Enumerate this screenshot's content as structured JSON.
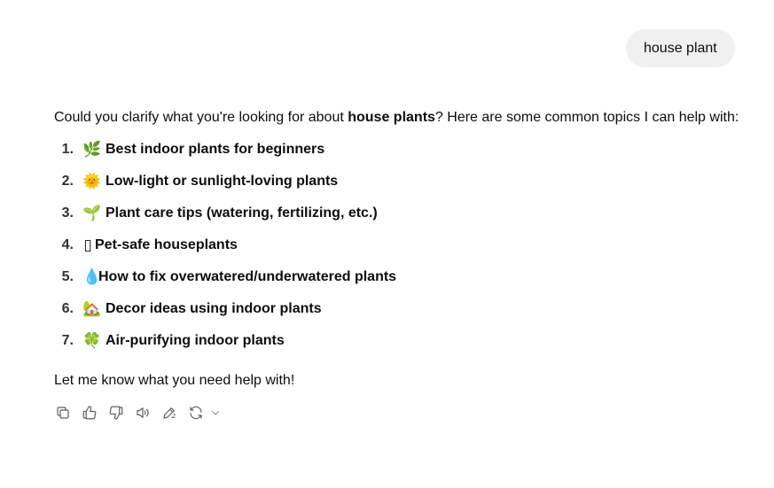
{
  "user_message": "house plant",
  "assistant": {
    "intro_before": "Could you clarify what you're looking for about ",
    "intro_bold": "house plants",
    "intro_after": "? Here are some common topics I can help with:",
    "topics": [
      {
        "num": "1.",
        "emoji": "🌿",
        "label": "Best indoor plants for beginners"
      },
      {
        "num": "2.",
        "emoji": "🌞",
        "label": "Low-light or sunlight-loving plants"
      },
      {
        "num": "3.",
        "emoji": "🌱",
        "label": "Plant care tips (watering, fertilizing, etc.)"
      },
      {
        "num": "4.",
        "emoji": "▯",
        "label": "Pet-safe houseplants"
      },
      {
        "num": "5.",
        "emoji": "💧",
        "label": "How to fix overwatered/underwatered plants"
      },
      {
        "num": "6.",
        "emoji": "🏡",
        "label": "Decor ideas using indoor plants"
      },
      {
        "num": "7.",
        "emoji": "🍀",
        "label": "Air-purifying indoor plants"
      }
    ],
    "outro": "Let me know what you need help with!"
  },
  "actions": [
    {
      "icon": "copy-icon"
    },
    {
      "icon": "thumbs-up-icon"
    },
    {
      "icon": "thumbs-down-icon"
    },
    {
      "icon": "read-aloud-icon"
    },
    {
      "icon": "edit-icon"
    },
    {
      "icon": "regenerate-icon"
    }
  ]
}
